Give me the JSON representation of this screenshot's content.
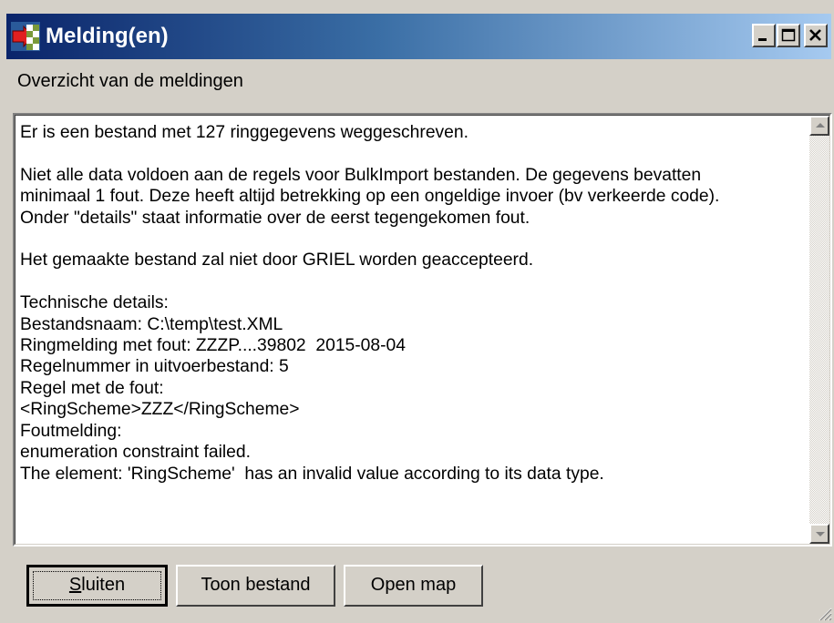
{
  "window": {
    "title": "Melding(en)",
    "icon": "app-icon",
    "controls": [
      "minimize-icon",
      "maximize-icon",
      "close-icon"
    ]
  },
  "subtitle": "Overzicht van de meldingen",
  "message": {
    "lines": [
      "Er is een bestand met 127 ringgegevens weggeschreven.",
      "",
      "Niet alle data voldoen aan de regels voor BulkImport bestanden. De gegevens bevatten",
      "minimaal 1 fout. Deze heeft altijd betrekking op een ongeldige invoer (bv verkeerde code).",
      "Onder \"details\" staat informatie over de eerst tegengekomen fout.",
      "",
      "Het gemaakte bestand zal niet door GRIEL worden geaccepteerd.",
      "",
      "Technische details:",
      "Bestandsnaam: C:\\temp\\test.XML",
      "Ringmelding met fout: ZZZP....39802  2015-08-04",
      "Regelnummer in uitvoerbestand: 5",
      "Regel met de fout:",
      "<RingScheme>ZZZ</RingScheme>",
      "Foutmelding:",
      "enumeration constraint failed.",
      "The element: 'RingScheme'  has an invalid value according to its data type."
    ]
  },
  "buttons": {
    "close": {
      "accel": "S",
      "rest": "luiten"
    },
    "show_file": "Toon bestand",
    "open_folder": "Open map"
  }
}
